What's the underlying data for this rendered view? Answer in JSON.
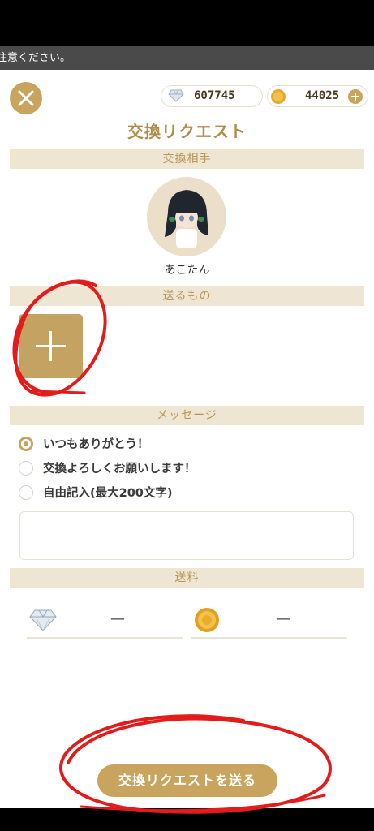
{
  "notice": {
    "text": "注意ください。"
  },
  "header": {
    "diamond_count": "607745",
    "coin_count": "44025",
    "title": "交換リクエスト"
  },
  "sections": {
    "partner": "交換相手",
    "send_items": "送るもの",
    "message": "メッセージ",
    "shipping": "送料"
  },
  "partner": {
    "name": "あこたん"
  },
  "message_options": [
    {
      "label": "いつもありがとう！",
      "selected": true
    },
    {
      "label": "交換よろしくお願いします！",
      "selected": false
    },
    {
      "label": "自由記入(最大200文字)",
      "selected": false
    }
  ],
  "free_text": {
    "value": ""
  },
  "shipping": {
    "diamond_fee": "—",
    "coin_fee": "—"
  },
  "submit": {
    "label": "交換リクエストを送る"
  },
  "colors": {
    "accent": "#c8a45e",
    "section_bg": "#efe5d3",
    "annotation": "#e31b1b"
  },
  "icons": [
    "close-icon",
    "diamond-icon",
    "coin-icon",
    "plus-icon",
    "avatar"
  ]
}
